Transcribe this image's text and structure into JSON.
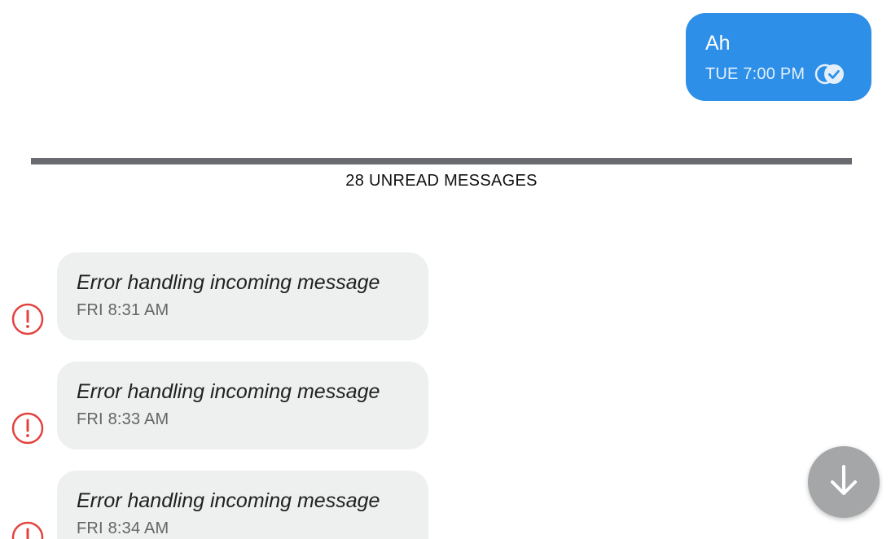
{
  "outgoing": {
    "text": "Ah",
    "timestamp": "TUE 7:00 PM",
    "status_icon": "double-check-icon"
  },
  "unread_divider": {
    "label": "28 UNREAD MESSAGES"
  },
  "messages": [
    {
      "text": "Error handling incoming message",
      "timestamp": "FRI 8:31 AM",
      "status_icon": "error-icon"
    },
    {
      "text": "Error handling incoming message",
      "timestamp": "FRI 8:33 AM",
      "status_icon": "error-icon"
    },
    {
      "text": "Error handling incoming message",
      "timestamp": "FRI 8:34 AM",
      "status_icon": "error-icon"
    }
  ],
  "scroll_button": {
    "icon": "arrow-down-icon"
  },
  "colors": {
    "outgoing_bubble": "#2d8fe7",
    "incoming_bubble": "#eef0f0",
    "error": "#e3433f",
    "divider": "#6a6b70",
    "fab": "#a4a6a8"
  }
}
